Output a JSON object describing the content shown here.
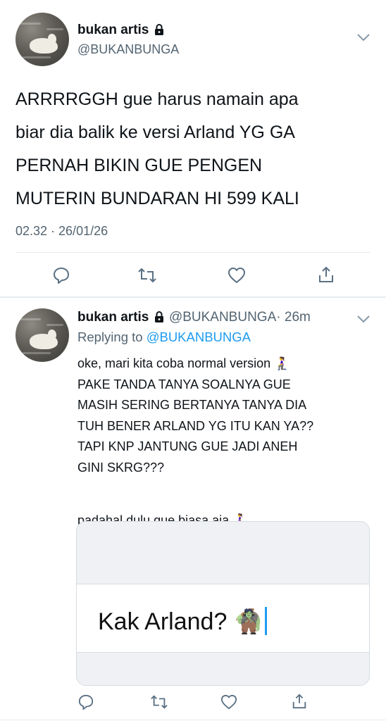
{
  "main_tweet": {
    "display_name": "bukan artis",
    "handle": "@BUKANBUNGA",
    "lines": [
      "ARRRRGGH gue harus namain apa",
      "biar dia balik ke versi Arland YG GA",
      "PERNAH BIKIN GUE PENGEN",
      "MUTERIN BUNDARAN HI 599 KALI"
    ],
    "timestamp": "02.32 · 26/01/26",
    "actions": [
      "reply-icon",
      "retweet-icon",
      "like-icon",
      "share-icon"
    ]
  },
  "reply_tweet": {
    "display_name": "bukan artis",
    "handle": "@BUKANBUNGA",
    "time_ago": "· 26m",
    "replying_label": "Replying to",
    "replying_to": "@BUKANBUNGA",
    "lines": [
      "oke, mari kita coba normal version 🧎‍♀️",
      "PAKE TANDA TANYA SOALNYA GUE",
      "MASIH SERING BERTANYA TANYA DIA",
      "TUH BENER ARLAND YG ITU KAN YA??",
      "TAPI KNP JANTUNG GUE JADI ANEH",
      "GINI SKRG???",
      "",
      "padahal dulu gue biasa aja 🚶‍♀️"
    ],
    "card_text": "Kak Arland? 🧌",
    "actions": [
      "reply-icon",
      "retweet-icon",
      "like-icon",
      "share-icon"
    ]
  },
  "colors": {
    "text": "#0f1419",
    "muted": "#536471",
    "link": "#1d9bf0",
    "divider": "#e6ecf0"
  }
}
